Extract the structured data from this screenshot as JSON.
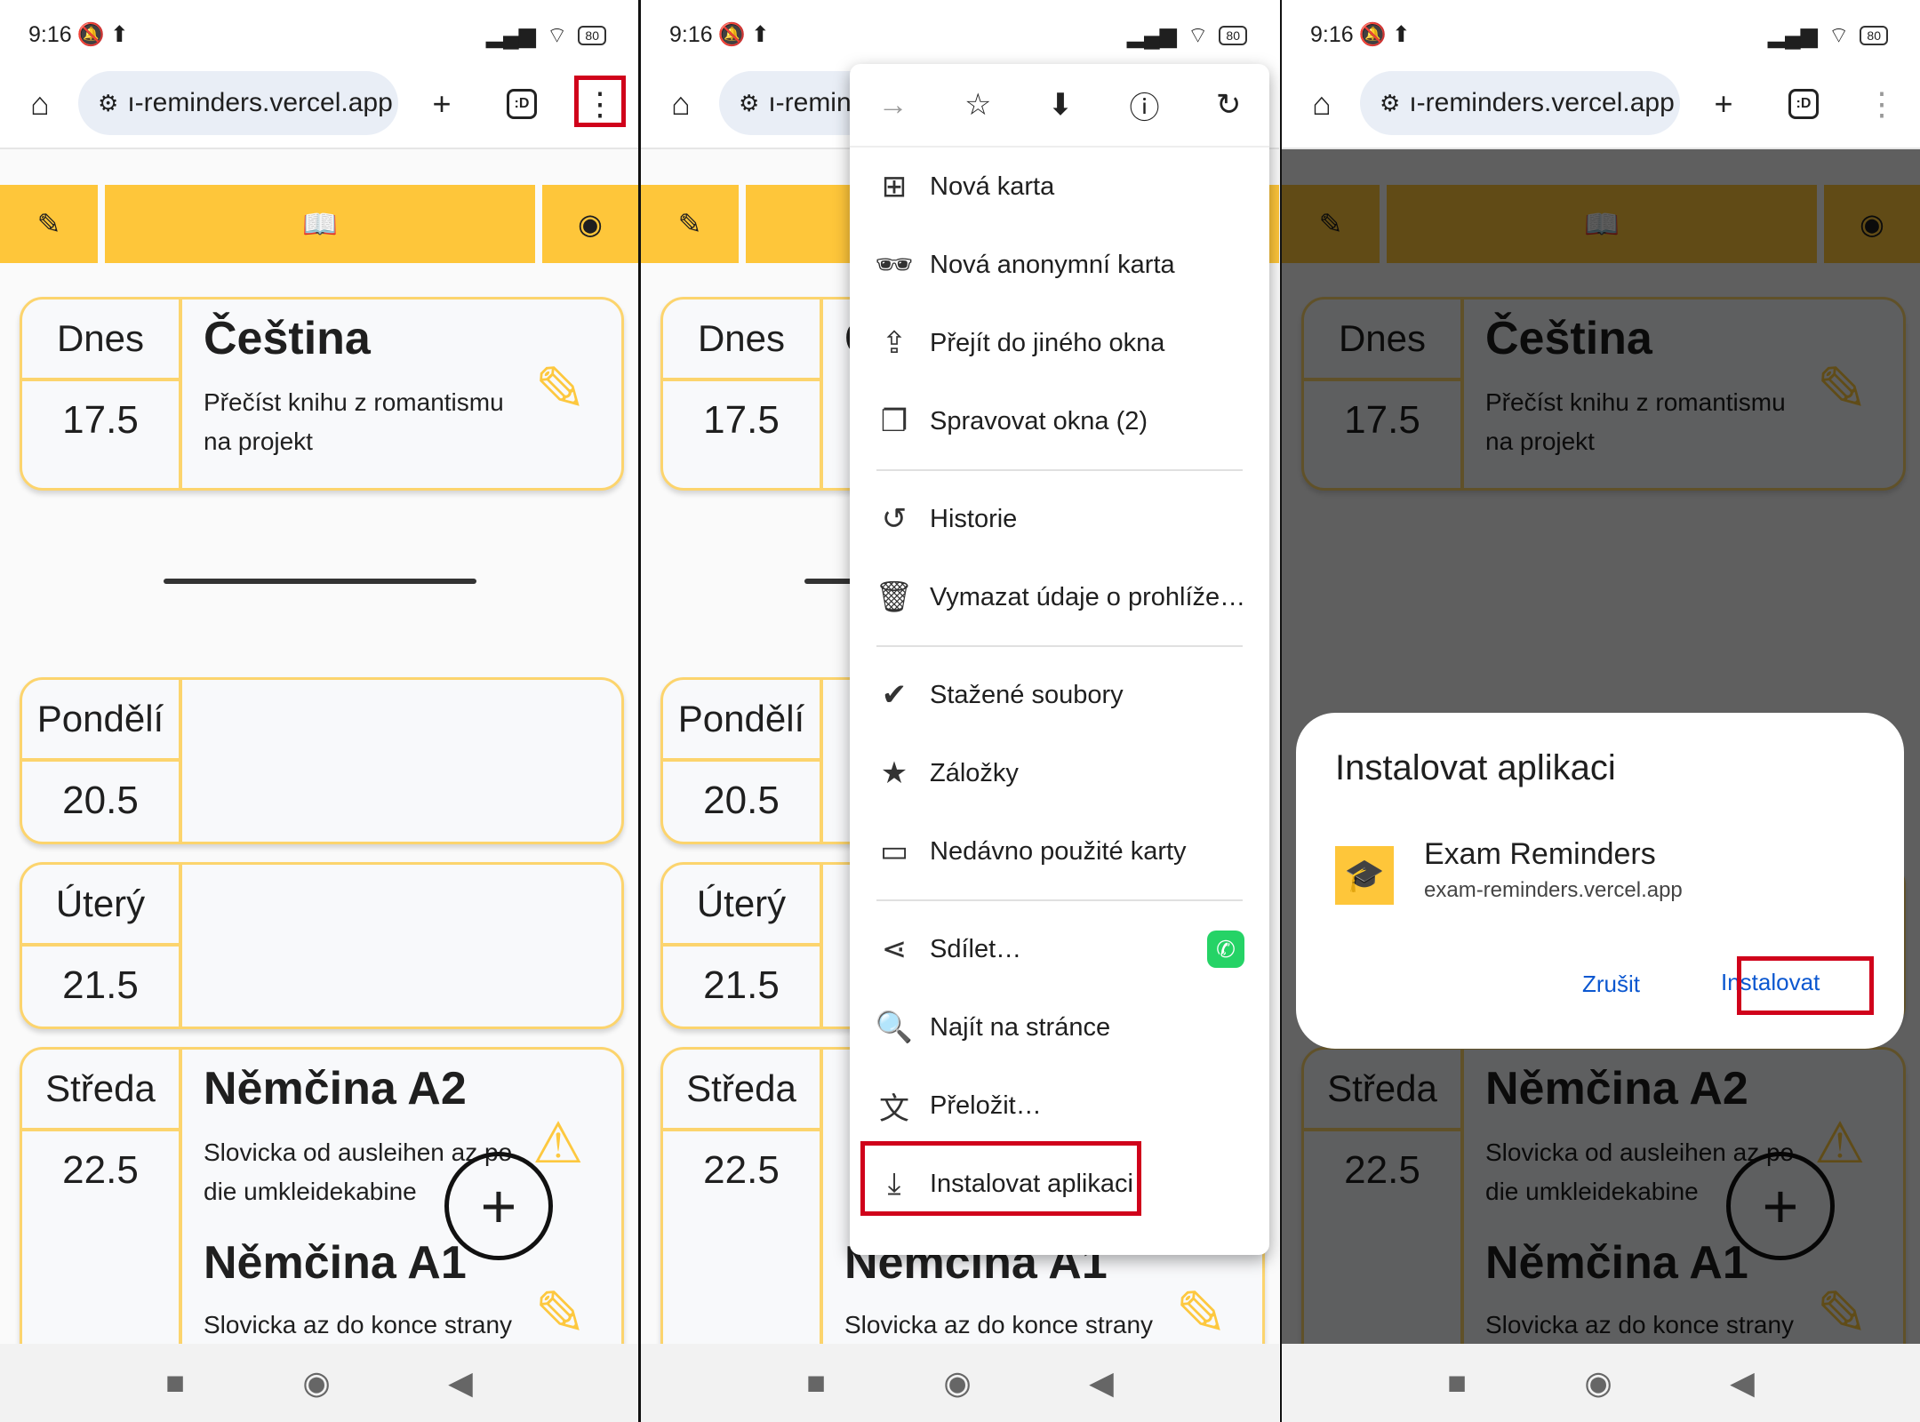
{
  "status": {
    "time": "9:16",
    "battery": "80"
  },
  "browser": {
    "url": "ı-reminders.vercel.app",
    "tab_count": ":D"
  },
  "cards": {
    "today": {
      "day": "Dnes",
      "date": "17.5",
      "subject": "Čeština",
      "desc_line1": "Přečíst knihu z romantismu",
      "desc_line2": "na projekt"
    },
    "monday": {
      "day": "Pondělí",
      "date": "20.5"
    },
    "tuesday": {
      "day": "Úterý",
      "date": "21.5"
    },
    "wednesday": {
      "day": "Středa",
      "date": "22.5",
      "subject1": "Němčina A2",
      "desc1_line1": "Slovicka od ausleihen az po",
      "desc1_line2": "die umkleidekabine",
      "subject2": "Němčina A1",
      "desc2_line1": "Slovicka az do konce strany"
    }
  },
  "menu": {
    "items": [
      {
        "label": "Nová karta"
      },
      {
        "label": "Nová anonymní karta"
      },
      {
        "label": "Přejít do jiného okna"
      },
      {
        "label": "Spravovat okna (2)"
      },
      {
        "label": "Historie"
      },
      {
        "label": "Vymazat údaje o prohlíže…"
      },
      {
        "label": "Stažené soubory"
      },
      {
        "label": "Záložky"
      },
      {
        "label": "Nedávno použité karty"
      },
      {
        "label": "Sdílet…"
      },
      {
        "label": "Najít na stránce"
      },
      {
        "label": "Přeložit…"
      },
      {
        "label": "Instalovat aplikaci"
      }
    ]
  },
  "dialog": {
    "title": "Instalovat aplikaci",
    "app_name": "Exam Reminders",
    "app_url": "exam-reminders.vercel.app",
    "cancel": "Zrušit",
    "install": "Instalovat"
  },
  "colors": {
    "accent": "#fec63a",
    "highlight": "#d0021b",
    "link": "#0b57d0"
  }
}
